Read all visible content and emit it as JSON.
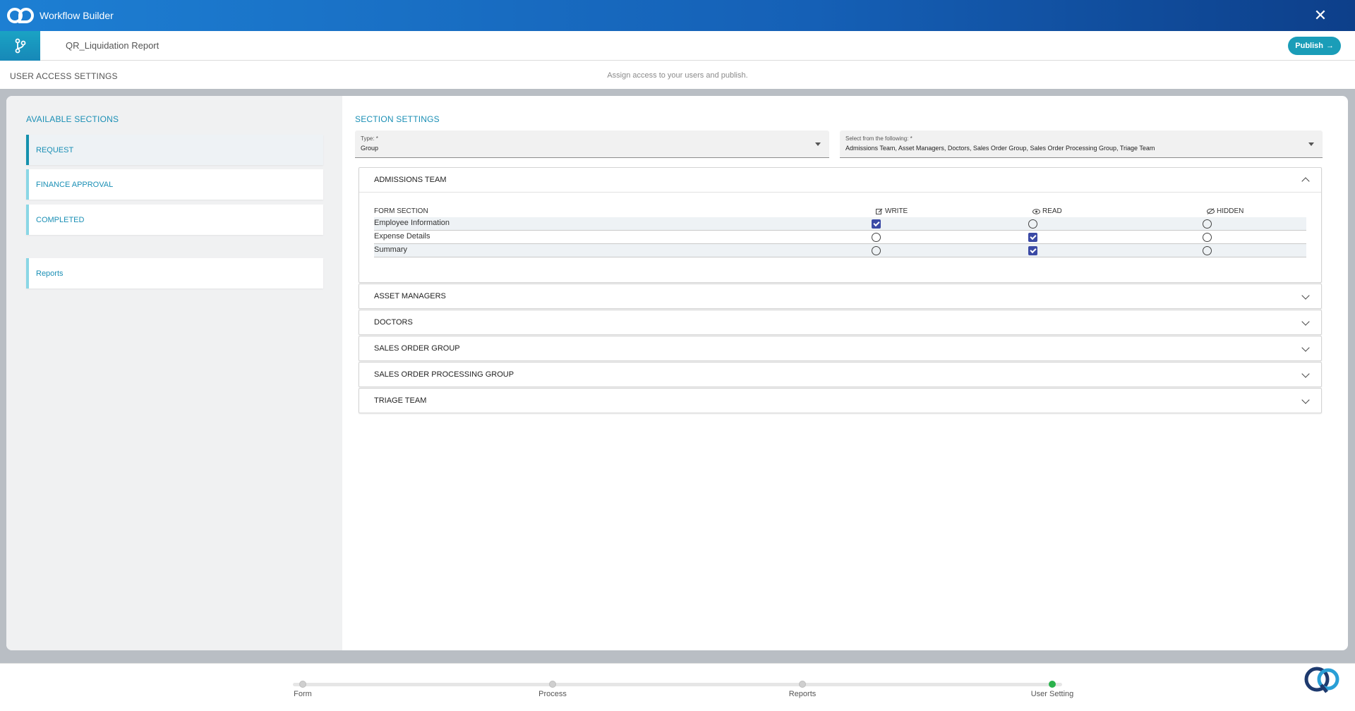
{
  "app": {
    "title": "Workflow Builder"
  },
  "header": {
    "report_name": "QR_Liquidation Report",
    "publish_label": "Publish"
  },
  "subheader": {
    "title": "USER ACCESS SETTINGS",
    "hint": "Assign access to your users and publish."
  },
  "available_sections": {
    "title": "AVAILABLE SECTIONS",
    "items": [
      {
        "label": "REQUEST"
      },
      {
        "label": "FINANCE APPROVAL"
      },
      {
        "label": "COMPLETED"
      },
      {
        "label": "Reports"
      }
    ]
  },
  "section_settings": {
    "title": "SECTION SETTINGS",
    "type_select": {
      "label": "Type: *",
      "value": "Group"
    },
    "members_select": {
      "label": "Select from the following: *",
      "value": "Admissions Team, Asset Managers, Doctors, Sales Order Group, Sales Order Processing Group, Triage Team"
    }
  },
  "permissions_header": {
    "form_section": "FORM SECTION",
    "write": "WRITE",
    "read": "READ",
    "hidden": "HIDDEN"
  },
  "groups": [
    {
      "name": "ADMISSIONS TEAM",
      "expanded": true,
      "rows": [
        {
          "section": "Employee Information",
          "access": "write"
        },
        {
          "section": "Expense Details",
          "access": "read"
        },
        {
          "section": "Summary",
          "access": "read"
        }
      ]
    },
    {
      "name": "ASSET MANAGERS",
      "expanded": false
    },
    {
      "name": "DOCTORS",
      "expanded": false
    },
    {
      "name": "SALES ORDER GROUP",
      "expanded": false
    },
    {
      "name": "SALES ORDER PROCESSING GROUP",
      "expanded": false
    },
    {
      "name": "TRIAGE TEAM",
      "expanded": false
    }
  ],
  "stepper": [
    {
      "label": "Form",
      "done": false
    },
    {
      "label": "Process",
      "done": false
    },
    {
      "label": "Reports",
      "done": false
    },
    {
      "label": "User Setting",
      "done": true
    }
  ],
  "colors": {
    "accent": "#1a9db8",
    "brand_blue": "#1560b6",
    "checkbox": "#3b4aa5",
    "step_done": "#2bb24c"
  }
}
